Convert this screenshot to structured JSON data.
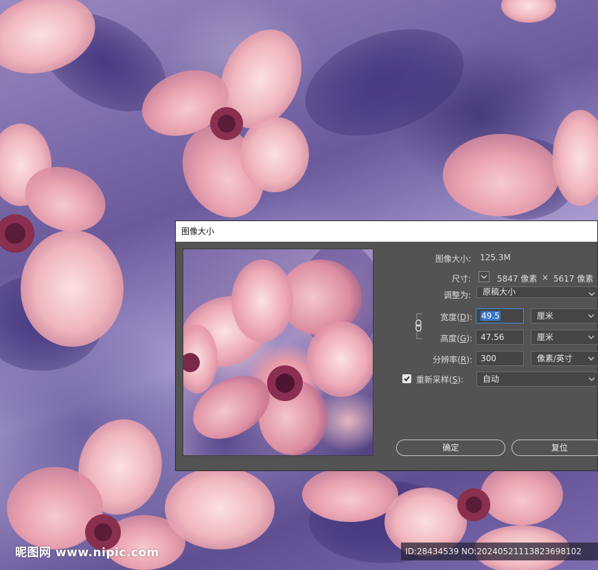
{
  "dialog": {
    "title": "图像大小",
    "image_size_label": "图像大小:",
    "image_size_value": "125.3M",
    "dimensions_label": "尺寸:",
    "dimensions_width_value": "5847 像素",
    "dimensions_times": "×",
    "dimensions_height_value": "5617 像素",
    "fit_to_label": "调整为:",
    "fit_to_value": "原稿大小",
    "width_label": "宽度(",
    "width_key": "D",
    "width_label_end": "):",
    "width_value": "49.5",
    "width_unit": "厘米",
    "height_label": "高度(",
    "height_key": "G",
    "height_label_end": "):",
    "height_value": "47.56",
    "height_unit": "厘米",
    "resolution_label": "分辨率(",
    "resolution_key": "R",
    "resolution_label_end": "):",
    "resolution_value": "300",
    "resolution_unit": "像素/英寸",
    "resample_label": "重新采样(",
    "resample_key": "S",
    "resample_label_end": "):",
    "resample_checked": true,
    "resample_value": "自动",
    "ok_label": "确定",
    "reset_label": "复位"
  },
  "watermark": {
    "site_text": "昵图网 www.nipic.com",
    "id_text": "ID:28434539 NO:20240521113823698102"
  },
  "colors": {
    "dialog_bg": "#535353",
    "field_bg": "#454545",
    "focus_blue": "#3d8bd6",
    "selection_blue": "#3876c8"
  },
  "icons": {
    "link": "chain-link-icon",
    "dimensions_toggle": "chevron-down-icon",
    "resample_check": "checkmark-icon"
  }
}
